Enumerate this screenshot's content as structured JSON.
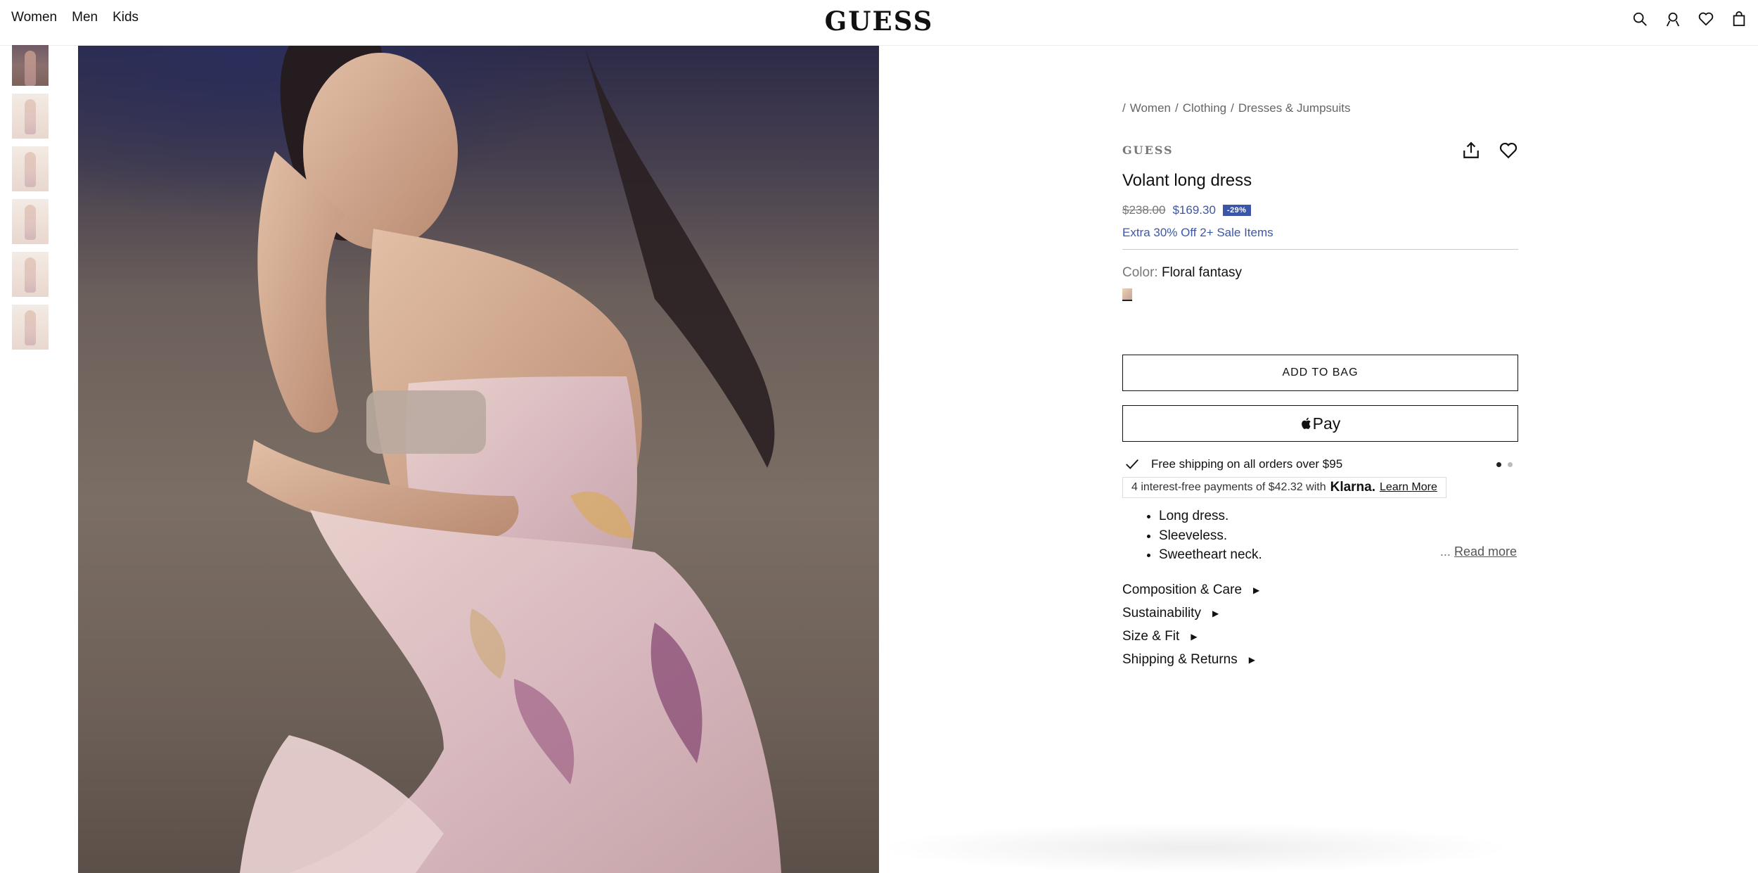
{
  "header": {
    "nav": [
      "Women",
      "Men",
      "Kids"
    ],
    "logo": "GUESS",
    "icons": [
      "search-icon",
      "account-icon",
      "wishlist-icon",
      "bag-icon"
    ]
  },
  "gallery": {
    "thumbnail_count": 6,
    "active_index": 0
  },
  "breadcrumb": [
    "Women",
    "Clothing",
    "Dresses & Jumpsuits"
  ],
  "product": {
    "brand": "GUESS",
    "title": "Volant long dress",
    "price_old": "$238.00",
    "price_new": "$169.30",
    "discount": "-29%",
    "promo": "Extra 30% Off 2+ Sale Items",
    "color_label": "Color:",
    "color_value": "Floral fantasy",
    "add_to_bag": "ADD TO BAG",
    "apple_pay": "Pay",
    "shipping": "Free shipping on all orders over $95",
    "klarna": {
      "text": "4 interest-free payments of $42.32 with",
      "logo": "Klarna.",
      "link": "Learn More"
    },
    "description": [
      "Long dress.",
      "Sleeveless.",
      "Sweetheart neck."
    ],
    "read_more_prefix": "...",
    "read_more": "Read more",
    "accordions": [
      "Composition & Care",
      "Sustainability",
      "Size & Fit",
      "Shipping & Returns"
    ]
  },
  "colors": {
    "accent": "#3b55a8",
    "text": "#111111"
  }
}
